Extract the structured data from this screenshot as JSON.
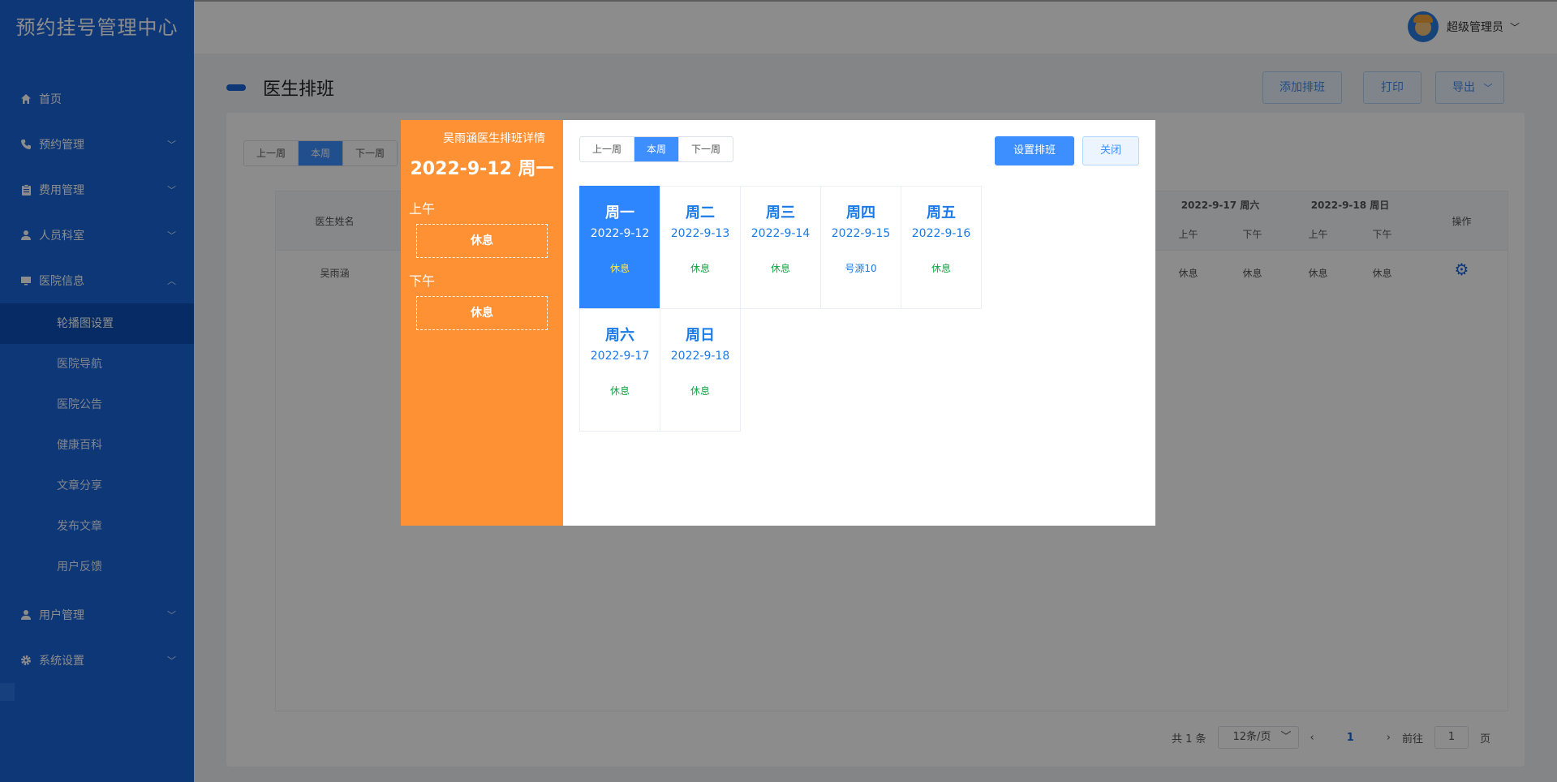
{
  "app": {
    "title": "预约挂号管理中心"
  },
  "sidebar": {
    "items": [
      {
        "label": "首页",
        "icon": "home-icon"
      },
      {
        "label": "预约管理",
        "icon": "phone-icon"
      },
      {
        "label": "费用管理",
        "icon": "clipboard-icon"
      },
      {
        "label": "人员科室",
        "icon": "person-icon"
      },
      {
        "label": "医院信息",
        "icon": "monitor-icon"
      },
      {
        "label": "用户管理",
        "icon": "person-icon"
      },
      {
        "label": "系统设置",
        "icon": "gear-icon"
      }
    ],
    "sub_items": [
      "轮播图设置",
      "医院导航",
      "医院公告",
      "健康百科",
      "文章分享",
      "发布文章",
      "用户反馈"
    ]
  },
  "header": {
    "user_name": "超级管理员"
  },
  "page": {
    "title": "医生排班",
    "add_label": "添加排班",
    "print_label": "打印",
    "export_label": "导出"
  },
  "week_tabs": {
    "prev": "上一周",
    "current": "本周",
    "next": "下一周"
  },
  "table": {
    "doctor_col": "医生姓名",
    "actions_col": "操作",
    "day_headers": [
      "2022-9-17 周六",
      "2022-9-18 周日"
    ],
    "am": "上午",
    "pm": "下午",
    "row": {
      "name": "吴雨涵",
      "cells": [
        "休息",
        "休息",
        "休息",
        "休息"
      ]
    }
  },
  "pagination": {
    "total": "共 1 条",
    "page_size": "12条/页",
    "current": "1",
    "goto": "前往",
    "goto_value": "1",
    "page_unit": "页"
  },
  "modal": {
    "title": "吴雨涵医生排班详情",
    "selected_date": "2022-9-12 周一",
    "am_label": "上午",
    "am_status": "休息",
    "pm_label": "下午",
    "pm_status": "休息",
    "tabs": {
      "prev": "上一周",
      "current": "本周",
      "next": "下一周"
    },
    "set_label": "设置排班",
    "close_label": "关闭",
    "days": [
      {
        "weekday": "周一",
        "date": "2022-9-12",
        "status": "休息"
      },
      {
        "weekday": "周二",
        "date": "2022-9-13",
        "status": "休息"
      },
      {
        "weekday": "周三",
        "date": "2022-9-14",
        "status": "休息"
      },
      {
        "weekday": "周四",
        "date": "2022-9-15",
        "status": "号源10"
      },
      {
        "weekday": "周五",
        "date": "2022-9-16",
        "status": "休息"
      },
      {
        "weekday": "周六",
        "date": "2022-9-17",
        "status": "休息"
      },
      {
        "weekday": "周日",
        "date": "2022-9-18",
        "status": "休息"
      }
    ]
  },
  "colors": {
    "sidebar": "#1a65d9",
    "primary": "#3d8eff",
    "modal_side": "#ff9135",
    "status_rest": "#13a545",
    "status_source": "#1a7ae8"
  }
}
